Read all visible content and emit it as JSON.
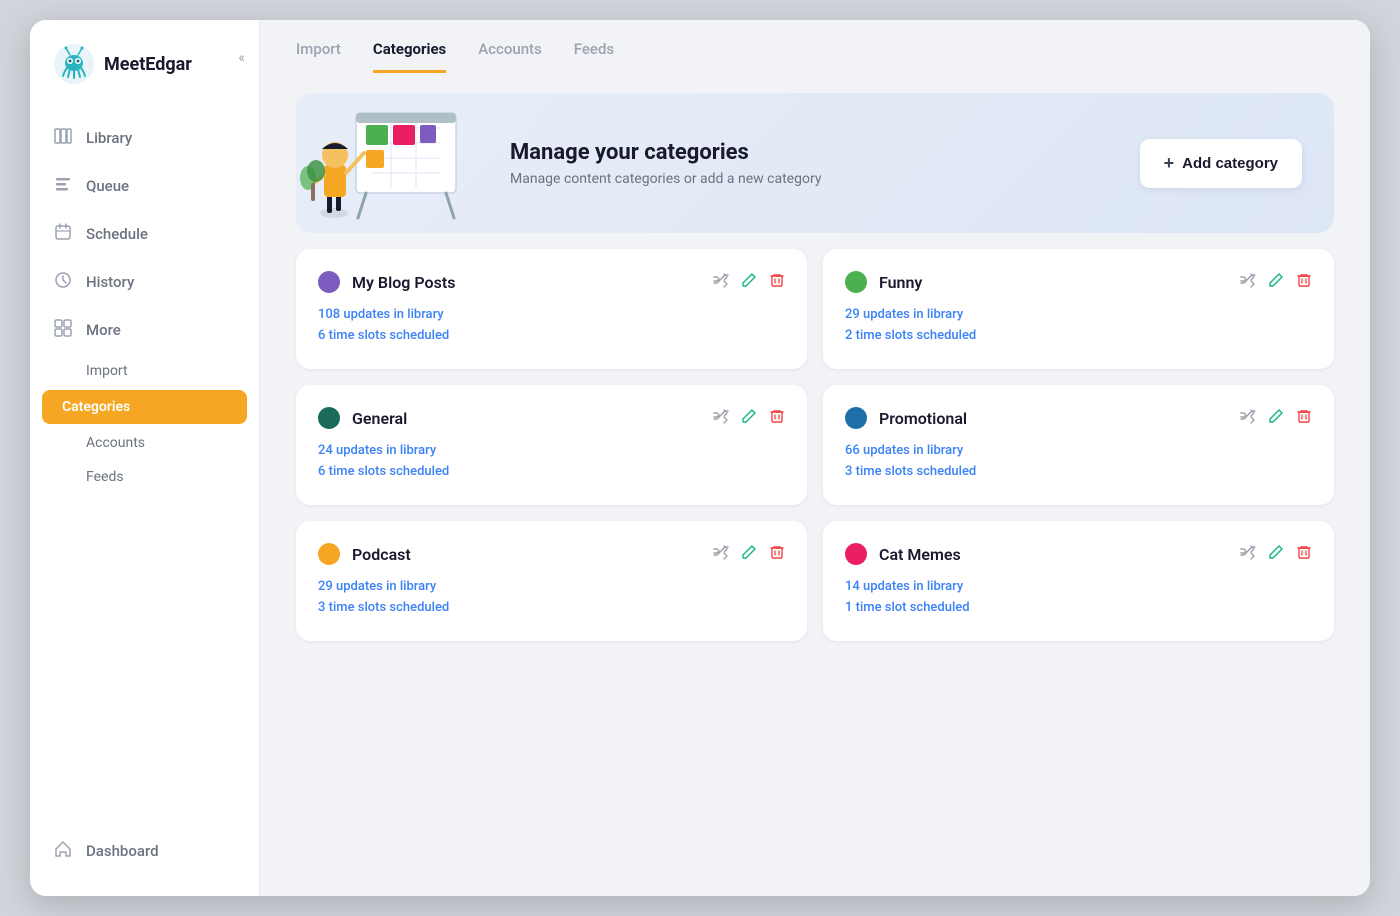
{
  "app": {
    "name": "MeetEdgar"
  },
  "sidebar": {
    "collapse_label": "«",
    "nav_items": [
      {
        "id": "library",
        "label": "Library",
        "icon": "📋"
      },
      {
        "id": "queue",
        "label": "Queue",
        "icon": "≡"
      },
      {
        "id": "schedule",
        "label": "Schedule",
        "icon": "📅"
      },
      {
        "id": "history",
        "label": "History",
        "icon": "🕐"
      },
      {
        "id": "more",
        "label": "More",
        "icon": "⊞"
      }
    ],
    "sub_items": [
      {
        "id": "import",
        "label": "Import",
        "active": false
      },
      {
        "id": "categories",
        "label": "Categories",
        "active": true
      },
      {
        "id": "accounts",
        "label": "Accounts",
        "active": false
      },
      {
        "id": "feeds",
        "label": "Feeds",
        "active": false
      }
    ],
    "footer_items": [
      {
        "id": "dashboard",
        "label": "Dashboard",
        "icon": "🏠"
      }
    ]
  },
  "tabs": [
    {
      "id": "import",
      "label": "Import",
      "active": false
    },
    {
      "id": "categories",
      "label": "Categories",
      "active": true
    },
    {
      "id": "accounts",
      "label": "Accounts",
      "active": false
    },
    {
      "id": "feeds",
      "label": "Feeds",
      "active": false
    }
  ],
  "banner": {
    "title": "Manage your categories",
    "subtitle": "Manage content categories or add a new category",
    "add_button": "Add category"
  },
  "categories": [
    {
      "id": "my-blog-posts",
      "name": "My Blog Posts",
      "color": "#7c5cbf",
      "updates_in_library": "108 updates in library",
      "time_slots_scheduled": "6 time slots scheduled"
    },
    {
      "id": "funny",
      "name": "Funny",
      "color": "#4caf50",
      "updates_in_library": "29 updates in library",
      "time_slots_scheduled": "2 time slots scheduled"
    },
    {
      "id": "general",
      "name": "General",
      "color": "#1a6b5a",
      "updates_in_library": "24 updates in library",
      "time_slots_scheduled": "6 time slots scheduled"
    },
    {
      "id": "promotional",
      "name": "Promotional",
      "color": "#1e6fa8",
      "updates_in_library": "66 updates in library",
      "time_slots_scheduled": "3 time slots scheduled"
    },
    {
      "id": "podcast",
      "name": "Podcast",
      "color": "#f5a623",
      "updates_in_library": "29 updates in library",
      "time_slots_scheduled": "3 time slots scheduled"
    },
    {
      "id": "cat-memes",
      "name": "Cat Memes",
      "color": "#e91e63",
      "updates_in_library": "14 updates in library",
      "time_slots_scheduled": "1 time slot scheduled"
    }
  ]
}
